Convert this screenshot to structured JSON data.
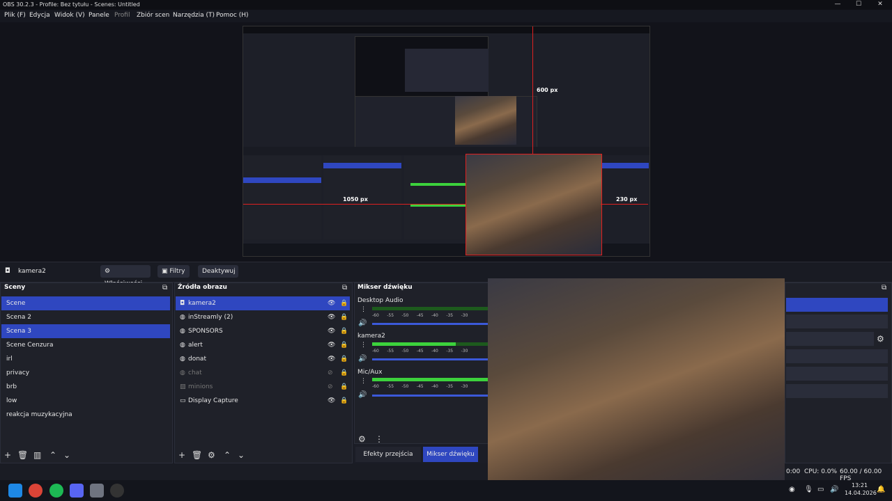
{
  "window": {
    "title": "OBS 30.2.3 - Profile: Bez tytułu - Scenes: Untitled",
    "min": "—",
    "max": "☐",
    "close": "✕"
  },
  "menu": [
    "Plik (F)",
    "Edycja",
    "Widok (V)",
    "Panele",
    "Profil",
    "Zbiór scen",
    "Narzędzia (T)",
    "Pomoc (H)"
  ],
  "overlay_labels": {
    "h600": "600 px",
    "w1050": "1050 px",
    "w230": "230 px"
  },
  "context": {
    "source": "kamera2",
    "properties": "Właściwości",
    "filters": "Filtry",
    "deactivate": "Deaktywuj"
  },
  "scenes": {
    "title": "Sceny",
    "items": [
      "Scene",
      "Scena 2",
      "Scena 3",
      "Scene Cenzura",
      "irl",
      "privacy",
      "brb",
      "low",
      "reakcja muzykacyjna"
    ]
  },
  "sources": {
    "title": "Źródła obrazu",
    "items": [
      "kamera2",
      "inStreamly (2)",
      "SPONSORS",
      "alert",
      "donat",
      "chat",
      "minions",
      "Display Capture"
    ]
  },
  "mixer": {
    "title": "Mikser dźwięku",
    "channels": [
      "Desktop Audio",
      "kamera2",
      "Mic/Aux"
    ],
    "ticks": [
      "-60",
      "-55",
      "-50",
      "-45",
      "-40",
      "-35",
      "-30"
    ]
  },
  "tabs": {
    "transitions": "Efekty przejścia scen",
    "mixer": "Mikser dźwięku"
  },
  "status": {
    "time0": "0:00",
    "cpu": "CPU: 0.0%",
    "fps": "60.00 / 60.00 FPS"
  },
  "clock": {
    "time": "13:21",
    "date": "14.04.2026"
  },
  "colors": {
    "accent": "#2f47c0",
    "meter": "#3cd23c",
    "red": "#e02020"
  }
}
